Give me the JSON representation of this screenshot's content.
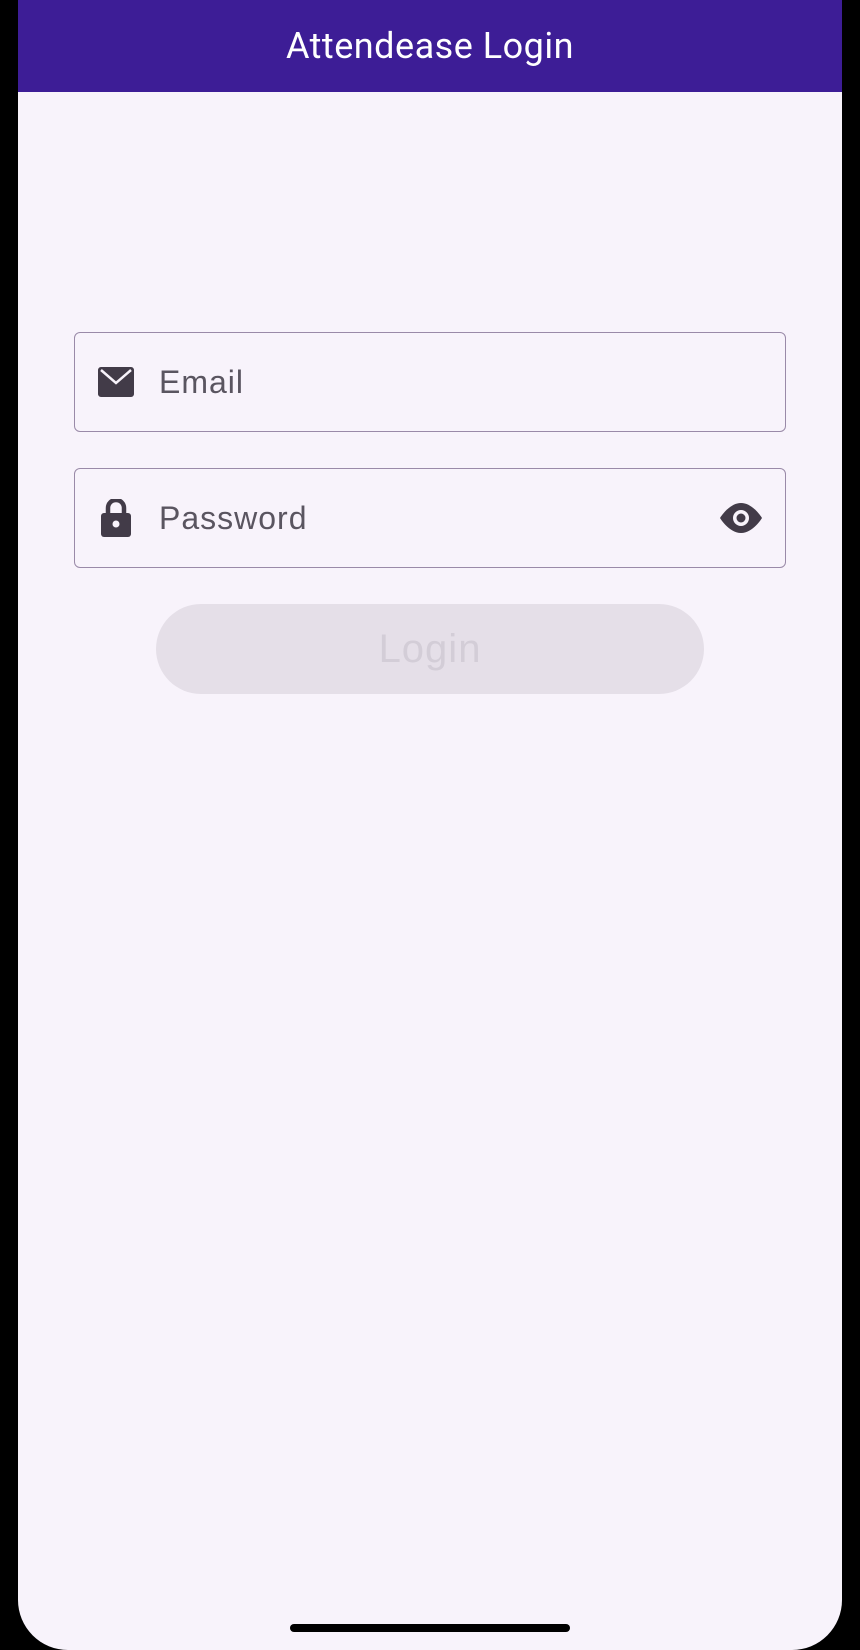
{
  "header": {
    "title": "Attendease Login"
  },
  "form": {
    "email": {
      "placeholder": "Email",
      "value": ""
    },
    "password": {
      "placeholder": "Password",
      "value": ""
    },
    "login_button_label": "Login"
  },
  "icons": {
    "email": "email-icon",
    "lock": "lock-icon",
    "eye": "eye-icon"
  }
}
